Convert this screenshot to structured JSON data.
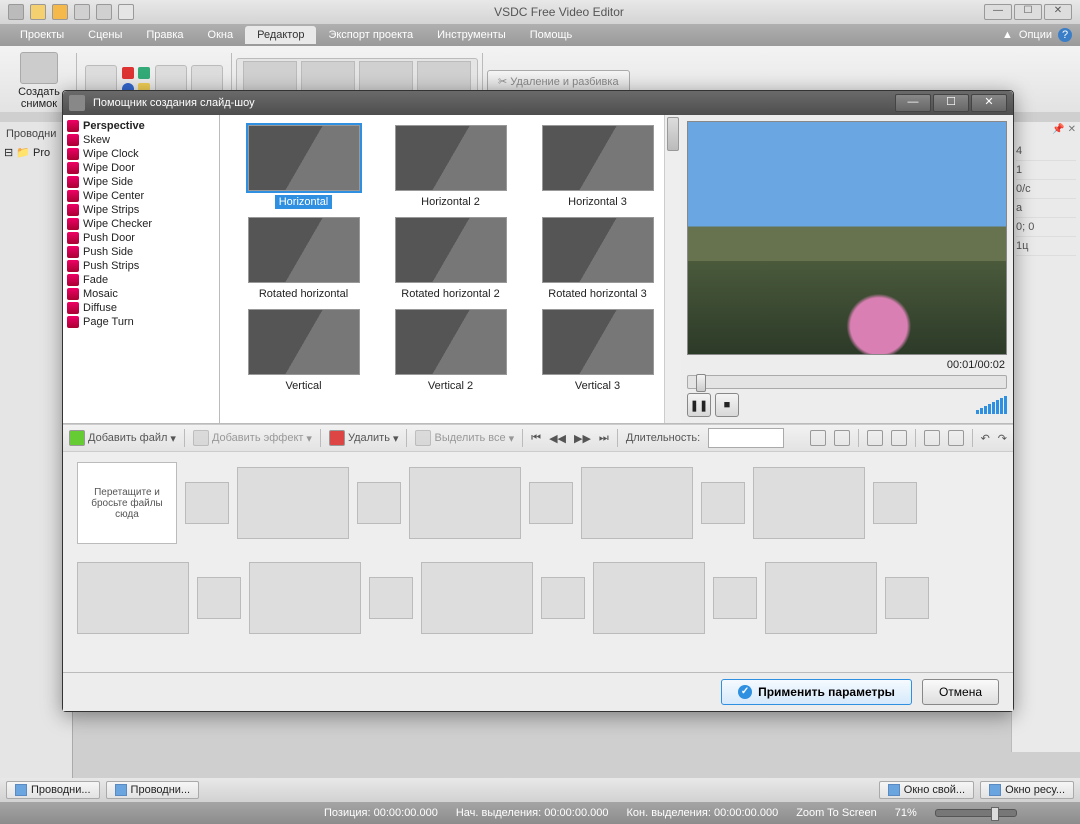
{
  "app": {
    "title": "VSDC Free Video Editor",
    "options_label": "Опции"
  },
  "menu": {
    "tabs": [
      "Проекты",
      "Сцены",
      "Правка",
      "Окна",
      "Редактор",
      "Экспорт проекта",
      "Инструменты",
      "Помощь"
    ],
    "active_index": 4
  },
  "ribbon": {
    "snapshot_label": "Создать снимок",
    "delete_split_label": "Удаление и разбивка"
  },
  "left_panel": {
    "header": "Проводни",
    "tree_root": "Pro"
  },
  "right_props": {
    "vals": [
      "4",
      "1",
      "0/с",
      "а",
      "0; 0",
      "1ц"
    ]
  },
  "dialog": {
    "title": "Помощник создания слайд-шоу",
    "effects": [
      "Perspective",
      "Skew",
      "Wipe Clock",
      "Wipe Door",
      "Wipe Side",
      "Wipe Center",
      "Wipe Strips",
      "Wipe Checker",
      "Push Door",
      "Push Side",
      "Push Strips",
      "Fade",
      "Mosaic",
      "Diffuse",
      "Page Turn"
    ],
    "selected_effect_index": 0,
    "thumbs": [
      "Horizontal",
      "Horizontal 2",
      "Horizontal 3",
      "Rotated horizontal",
      "Rotated horizontal 2",
      "Rotated horizontal 3",
      "Vertical",
      "Vertical 2",
      "Vertical 3"
    ],
    "selected_thumb_index": 0,
    "preview_time": "00:01/00:02",
    "toolbar": {
      "add_file": "Добавить файл",
      "add_effect": "Добавить эффект",
      "delete": "Удалить",
      "select_all": "Выделить все",
      "duration": "Длительность:"
    },
    "storyboard_drop": "Перетащите и бросьте файлы сюда",
    "apply_label": "Применить параметры",
    "cancel_label": "Отмена"
  },
  "taskbar": {
    "items": [
      "Проводни...",
      "Проводни...",
      "Окно свой...",
      "Окно ресу..."
    ]
  },
  "statusbar": {
    "position_label": "Позиция:",
    "position_value": "00:00:00.000",
    "sel_start_label": "Нач. выделения:",
    "sel_start_value": "00:00:00.000",
    "sel_end_label": "Кон. выделения:",
    "sel_end_value": "00:00:00.000",
    "zoom_label": "Zoom To Screen",
    "zoom_value": "71%"
  }
}
